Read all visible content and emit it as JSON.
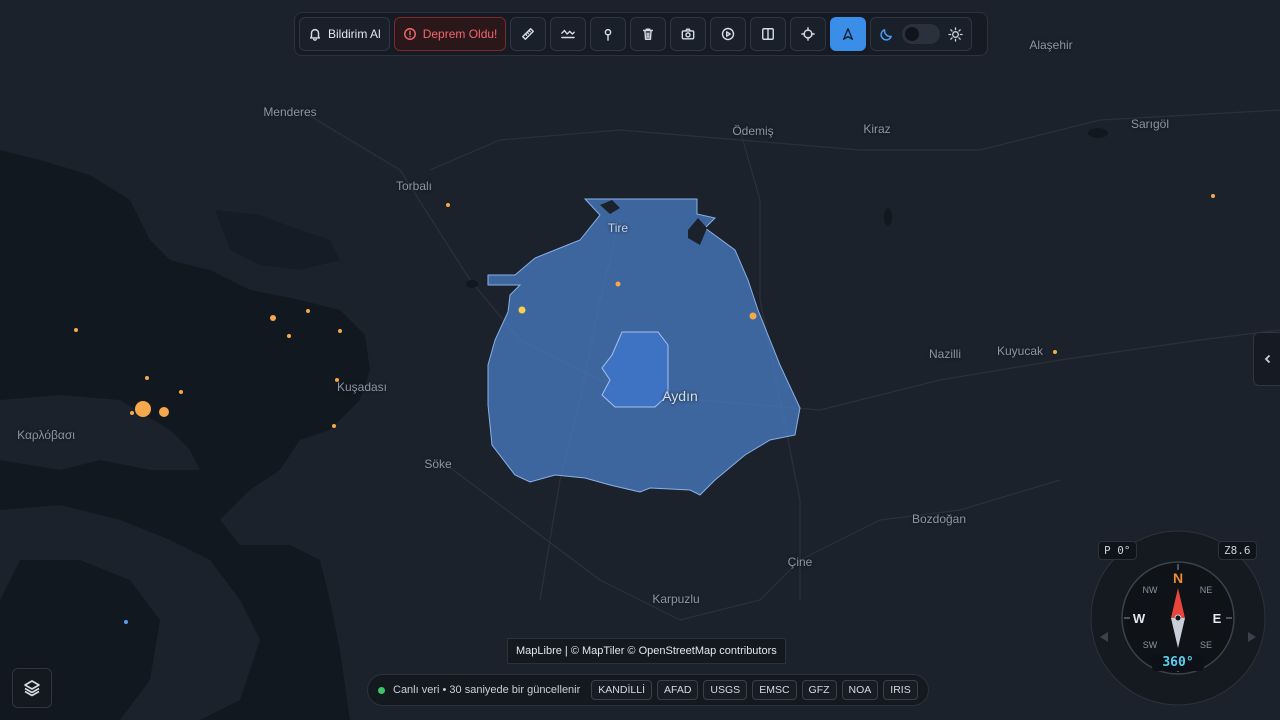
{
  "toolbar": {
    "notify_label": "Bildirim Al",
    "quake_label": "Deprem Oldu!",
    "tools": [
      "ruler-icon",
      "wave-icon",
      "pin-icon",
      "trash-icon",
      "camera-icon",
      "play-icon",
      "split-icon",
      "crosshair-icon",
      "navigate-icon"
    ],
    "active_tool": "navigate-icon",
    "theme": "dark"
  },
  "map": {
    "places": [
      {
        "name": "Menderes"
      },
      {
        "name": "Torbalı"
      },
      {
        "name": "Ödemiş"
      },
      {
        "name": "Kiraz"
      },
      {
        "name": "Alaşehir"
      },
      {
        "name": "Sarıgöl"
      },
      {
        "name": "Tire"
      },
      {
        "name": "Kuşadası"
      },
      {
        "name": "Καρλόβασι"
      },
      {
        "name": "Söke"
      },
      {
        "name": "Aydın"
      },
      {
        "name": "Nazilli"
      },
      {
        "name": "Kuyucak"
      },
      {
        "name": "Bozdoğan"
      },
      {
        "name": "Çine"
      },
      {
        "name": "Karpuzlu"
      }
    ],
    "highlight_color": "#4a7ec4",
    "quake_color": "#f5a94a"
  },
  "attribution": "MapLibre | © MapTiler © OpenStreetMap contributors",
  "status": {
    "text": "Canlı veri • 30 saniyede bir güncellenir",
    "sources": [
      "KANDİLLİ",
      "AFAD",
      "USGS",
      "EMSC",
      "GFZ",
      "NOA",
      "IRIS"
    ]
  },
  "compass": {
    "pitch": "P 0°",
    "zoom": "Z8.6",
    "bearing": "360°",
    "labels": {
      "n": "N",
      "ne": "NE",
      "e": "E",
      "se": "SE",
      "s": "S",
      "sw": "SW",
      "w": "W",
      "nw": "NW"
    }
  }
}
